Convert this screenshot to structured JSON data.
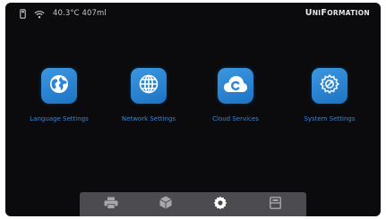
{
  "status_bar": {
    "temperature_volume": "40.3°C 407ml",
    "brand": {
      "first": "U",
      "rest1": "ni",
      "mid": "F",
      "rest2": "ormation"
    }
  },
  "settings_tiles": [
    {
      "label": "Language Settings",
      "icon": "globe-icon"
    },
    {
      "label": "Network Settings",
      "icon": "network-globe-icon"
    },
    {
      "label": "Cloud Services",
      "icon": "cloud-icon"
    },
    {
      "label": "System Settings",
      "icon": "system-gear-icon"
    }
  ],
  "dock": {
    "items": [
      "printer-icon",
      "model-cube-icon",
      "settings-gear-icon",
      "tools-box-icon"
    ],
    "active_item": "settings-gear-icon"
  },
  "colors": {
    "background": "#0b0b0d",
    "tile_blue": "#2a86d6",
    "label_blue": "#3f85cf",
    "dock": "#4c4c50"
  }
}
